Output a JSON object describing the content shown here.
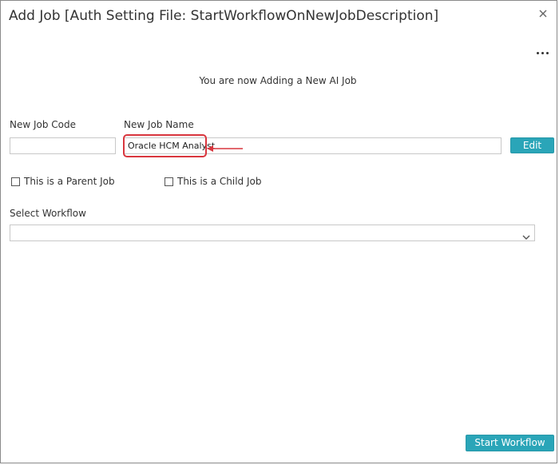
{
  "dialog": {
    "title": "Add Job [Auth Setting File: StartWorkflowOnNewJobDescription]",
    "subtitle": "You are now Adding a New AI Job"
  },
  "fields": {
    "job_code_label": "New Job Code",
    "job_code_value": "",
    "job_name_label": "New Job Name",
    "job_name_value": "Oracle HCM Analyst",
    "edit_button": "Edit"
  },
  "options": {
    "parent_job_label": "This is a Parent Job",
    "child_job_label": "This is a Child Job"
  },
  "workflow": {
    "label": "Select Workflow",
    "selected": ""
  },
  "footer": {
    "start_button": "Start Workflow"
  },
  "colors": {
    "accent": "#2aa5b8",
    "annotation": "#d9363e"
  }
}
